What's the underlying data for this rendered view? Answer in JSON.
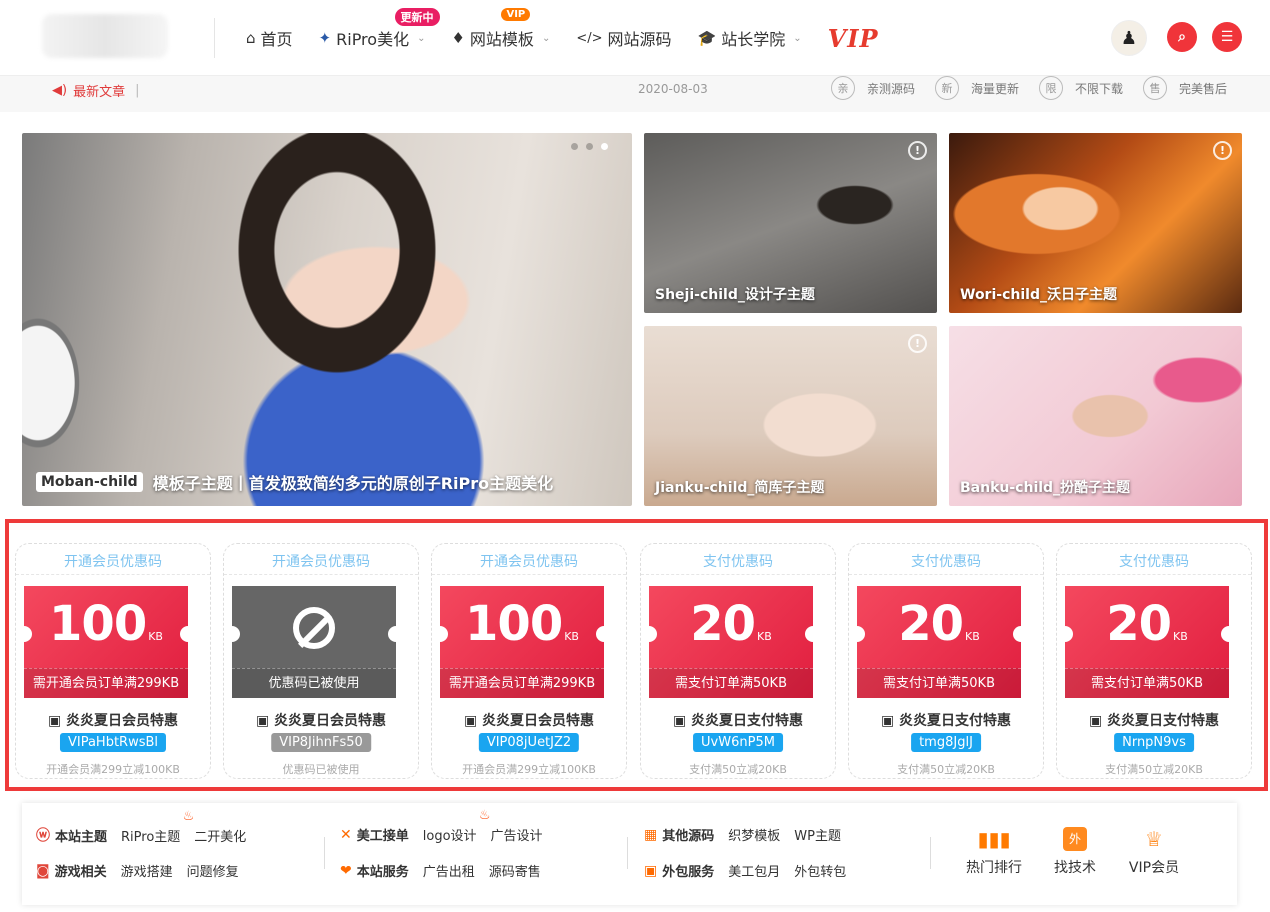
{
  "header": {
    "nav": [
      {
        "label": "首页",
        "icon": "home-icon",
        "glyph": "⌂"
      },
      {
        "label": "RiPro美化",
        "icon": "star-icon",
        "glyph": "✦",
        "badge": "更新中"
      },
      {
        "label": "网站模板",
        "icon": "flame-icon",
        "glyph": "♦",
        "badge": "VIP"
      },
      {
        "label": "网站源码",
        "icon": "code-icon",
        "glyph": "</>"
      },
      {
        "label": "站长学院",
        "icon": "graduation-cap-icon",
        "glyph": "🎓"
      }
    ],
    "vip_logo": "VIP",
    "colors": {
      "accent": "#f0343a",
      "vip": "#e63b2e"
    }
  },
  "notice": {
    "latest_label": "最新文章",
    "separator": "|",
    "date": "2020-08-03",
    "features": [
      {
        "char": "亲",
        "text": "亲测源码"
      },
      {
        "char": "新",
        "text": "海量更新"
      },
      {
        "char": "限",
        "text": "不限下载"
      },
      {
        "char": "售",
        "text": "完美售后"
      }
    ]
  },
  "banner": {
    "main": {
      "tag": "Moban-child",
      "title": "模板子主题丨首发极致简约多元的原创子RiPro主题美化"
    },
    "thumbs": [
      {
        "title": "Sheji-child_设计子主题"
      },
      {
        "title": "Wori-child_沃日子主题"
      },
      {
        "title": "Jianku-child_简库子主题"
      },
      {
        "title": "Banku-child_扮酷子主题"
      }
    ]
  },
  "coupons": [
    {
      "title": "开通会员优惠码",
      "amount": "100",
      "unit": "KB",
      "condition": "需开通会员订单满299KB",
      "name": "炎炎夏日会员特惠",
      "code": "VIPaHbtRwsBl",
      "footer": "开通会员满299立减100KB",
      "used": false
    },
    {
      "title": "开通会员优惠码",
      "amount": "",
      "unit": "",
      "condition": "优惠码已被使用",
      "name": "炎炎夏日会员特惠",
      "code": "VIP8JihnFs50",
      "footer": "优惠码已被使用",
      "used": true
    },
    {
      "title": "开通会员优惠码",
      "amount": "100",
      "unit": "KB",
      "condition": "需开通会员订单满299KB",
      "name": "炎炎夏日会员特惠",
      "code": "VIP08jUetJZ2",
      "footer": "开通会员满299立减100KB",
      "used": false
    },
    {
      "title": "支付优惠码",
      "amount": "20",
      "unit": "KB",
      "condition": "需支付订单满50KB",
      "name": "炎炎夏日支付特惠",
      "code": "UvW6nP5M",
      "footer": "支付满50立减20KB",
      "used": false
    },
    {
      "title": "支付优惠码",
      "amount": "20",
      "unit": "KB",
      "condition": "需支付订单满50KB",
      "name": "炎炎夏日支付特惠",
      "code": "tmg8JglJ",
      "footer": "支付满50立减20KB",
      "used": false
    },
    {
      "title": "支付优惠码",
      "amount": "20",
      "unit": "KB",
      "condition": "需支付订单满50KB",
      "name": "炎炎夏日支付特惠",
      "code": "NrnpN9vs",
      "footer": "支付满50立减20KB",
      "used": false
    }
  ],
  "bottom_nav": {
    "groups": [
      {
        "label": "本站主题",
        "links": [
          "RiPro主题",
          "二开美化"
        ]
      },
      {
        "label": "游戏相关",
        "links": [
          "游戏搭建",
          "问题修复"
        ]
      },
      {
        "label": "美工接单",
        "links": [
          "logo设计",
          "广告设计"
        ]
      },
      {
        "label": "本站服务",
        "links": [
          "广告出租",
          "源码寄售"
        ]
      },
      {
        "label": "其他源码",
        "links": [
          "织梦模板",
          "WP主题"
        ]
      },
      {
        "label": "外包服务",
        "links": [
          "美工包月",
          "外包转包"
        ]
      }
    ],
    "quick": [
      {
        "label": "热门排行",
        "icon": "bar-chart-icon"
      },
      {
        "label": "找技术",
        "icon": "outsource-icon",
        "glyph": "外"
      },
      {
        "label": "VIP会员",
        "icon": "crown-icon"
      }
    ]
  }
}
